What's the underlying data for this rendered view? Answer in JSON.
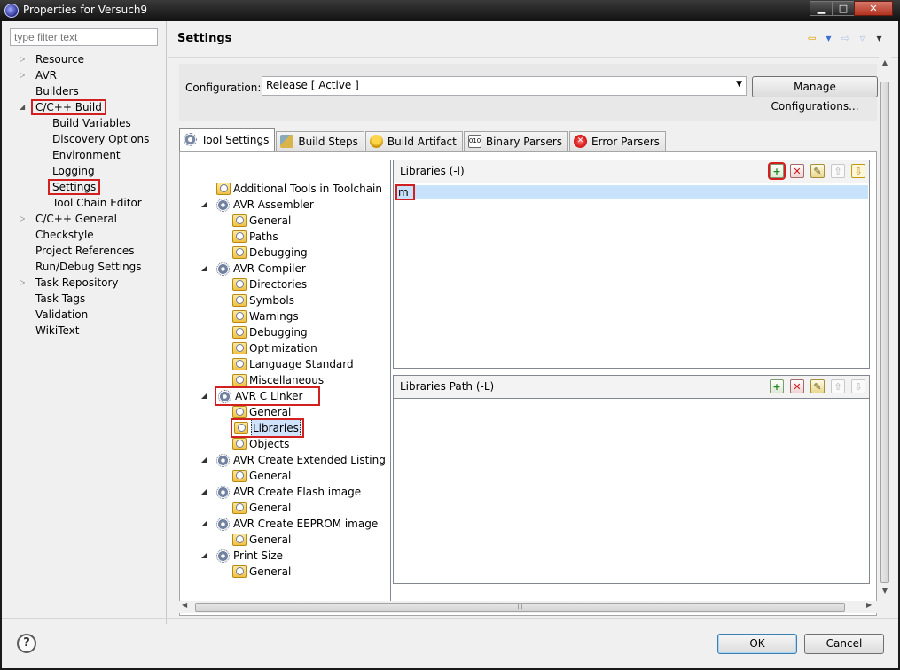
{
  "window": {
    "title": "Properties for Versuch9",
    "minimize": "▁",
    "maximize": "□",
    "close": "✕"
  },
  "filter": {
    "placeholder": "type filter text"
  },
  "nav": {
    "items": [
      {
        "label": "Resource",
        "expandable": true
      },
      {
        "label": "AVR",
        "expandable": true
      },
      {
        "label": "Builders",
        "expandable": false
      },
      {
        "label": "C/C++ Build",
        "expandable": true,
        "expanded": true
      },
      {
        "label": "Build Variables",
        "expandable": false
      },
      {
        "label": "Discovery Options",
        "expandable": false
      },
      {
        "label": "Environment",
        "expandable": false
      },
      {
        "label": "Logging",
        "expandable": false
      },
      {
        "label": "Settings",
        "expandable": false,
        "selected": true
      },
      {
        "label": "Tool Chain Editor",
        "expandable": false
      },
      {
        "label": "C/C++ General",
        "expandable": true
      },
      {
        "label": "Checkstyle",
        "expandable": false
      },
      {
        "label": "Project References",
        "expandable": false
      },
      {
        "label": "Run/Debug Settings",
        "expandable": false
      },
      {
        "label": "Task Repository",
        "expandable": true
      },
      {
        "label": "Task Tags",
        "expandable": false
      },
      {
        "label": "Validation",
        "expandable": false
      },
      {
        "label": "WikiText",
        "expandable": false
      }
    ]
  },
  "header": {
    "title": "Settings"
  },
  "configuration": {
    "label": "Configuration:",
    "value": "Release  [ Active ]",
    "manage_button": "Manage Configurations..."
  },
  "tabs": [
    {
      "label": "Tool Settings",
      "icon": "gear-icon",
      "active": true
    },
    {
      "label": "Build Steps",
      "icon": "build-steps-icon",
      "active": false
    },
    {
      "label": "Build Artifact",
      "icon": "trophy-icon",
      "active": false
    },
    {
      "label": "Binary Parsers",
      "icon": "binary-icon",
      "active": false
    },
    {
      "label": "Error Parsers",
      "icon": "error-icon",
      "active": false
    }
  ],
  "tool_tree": [
    {
      "label": "Additional Tools in Toolchain",
      "kind": "category"
    },
    {
      "label": "AVR Assembler",
      "kind": "tool"
    },
    {
      "label": "General",
      "kind": "category"
    },
    {
      "label": "Paths",
      "kind": "category"
    },
    {
      "label": "Debugging",
      "kind": "category"
    },
    {
      "label": "AVR Compiler",
      "kind": "tool"
    },
    {
      "label": "Directories",
      "kind": "category"
    },
    {
      "label": "Symbols",
      "kind": "category"
    },
    {
      "label": "Warnings",
      "kind": "category"
    },
    {
      "label": "Debugging",
      "kind": "category"
    },
    {
      "label": "Optimization",
      "kind": "category"
    },
    {
      "label": "Language Standard",
      "kind": "category"
    },
    {
      "label": "Miscellaneous",
      "kind": "category"
    },
    {
      "label": "AVR C Linker",
      "kind": "tool"
    },
    {
      "label": "General",
      "kind": "category"
    },
    {
      "label": "Libraries",
      "kind": "category",
      "selected": true
    },
    {
      "label": "Objects",
      "kind": "category"
    },
    {
      "label": "AVR Create Extended Listing",
      "kind": "tool"
    },
    {
      "label": "General",
      "kind": "category"
    },
    {
      "label": "AVR Create Flash image",
      "kind": "tool"
    },
    {
      "label": "General",
      "kind": "category"
    },
    {
      "label": "AVR Create EEPROM image",
      "kind": "tool"
    },
    {
      "label": "General",
      "kind": "category"
    },
    {
      "label": "Print Size",
      "kind": "tool"
    },
    {
      "label": "General",
      "kind": "category"
    }
  ],
  "libraries": {
    "title": "Libraries (-l)",
    "items": [
      "m"
    ]
  },
  "libraries_path": {
    "title": "Libraries Path (-L)",
    "items": []
  },
  "toolbar_icons": {
    "add": "add-icon",
    "delete": "delete-icon",
    "edit": "edit-icon",
    "up": "move-up-icon",
    "down": "move-down-icon"
  },
  "tool_glyphs": {
    "add": "+",
    "delete": "✕",
    "edit": "✎",
    "up": "⇧",
    "down": "⇩"
  },
  "footer": {
    "help": "?",
    "ok": "OK",
    "cancel": "Cancel"
  },
  "colors": {
    "highlight": "#d21f1f",
    "selection": "#c9e2fb",
    "accent": "#3c7fb1"
  }
}
